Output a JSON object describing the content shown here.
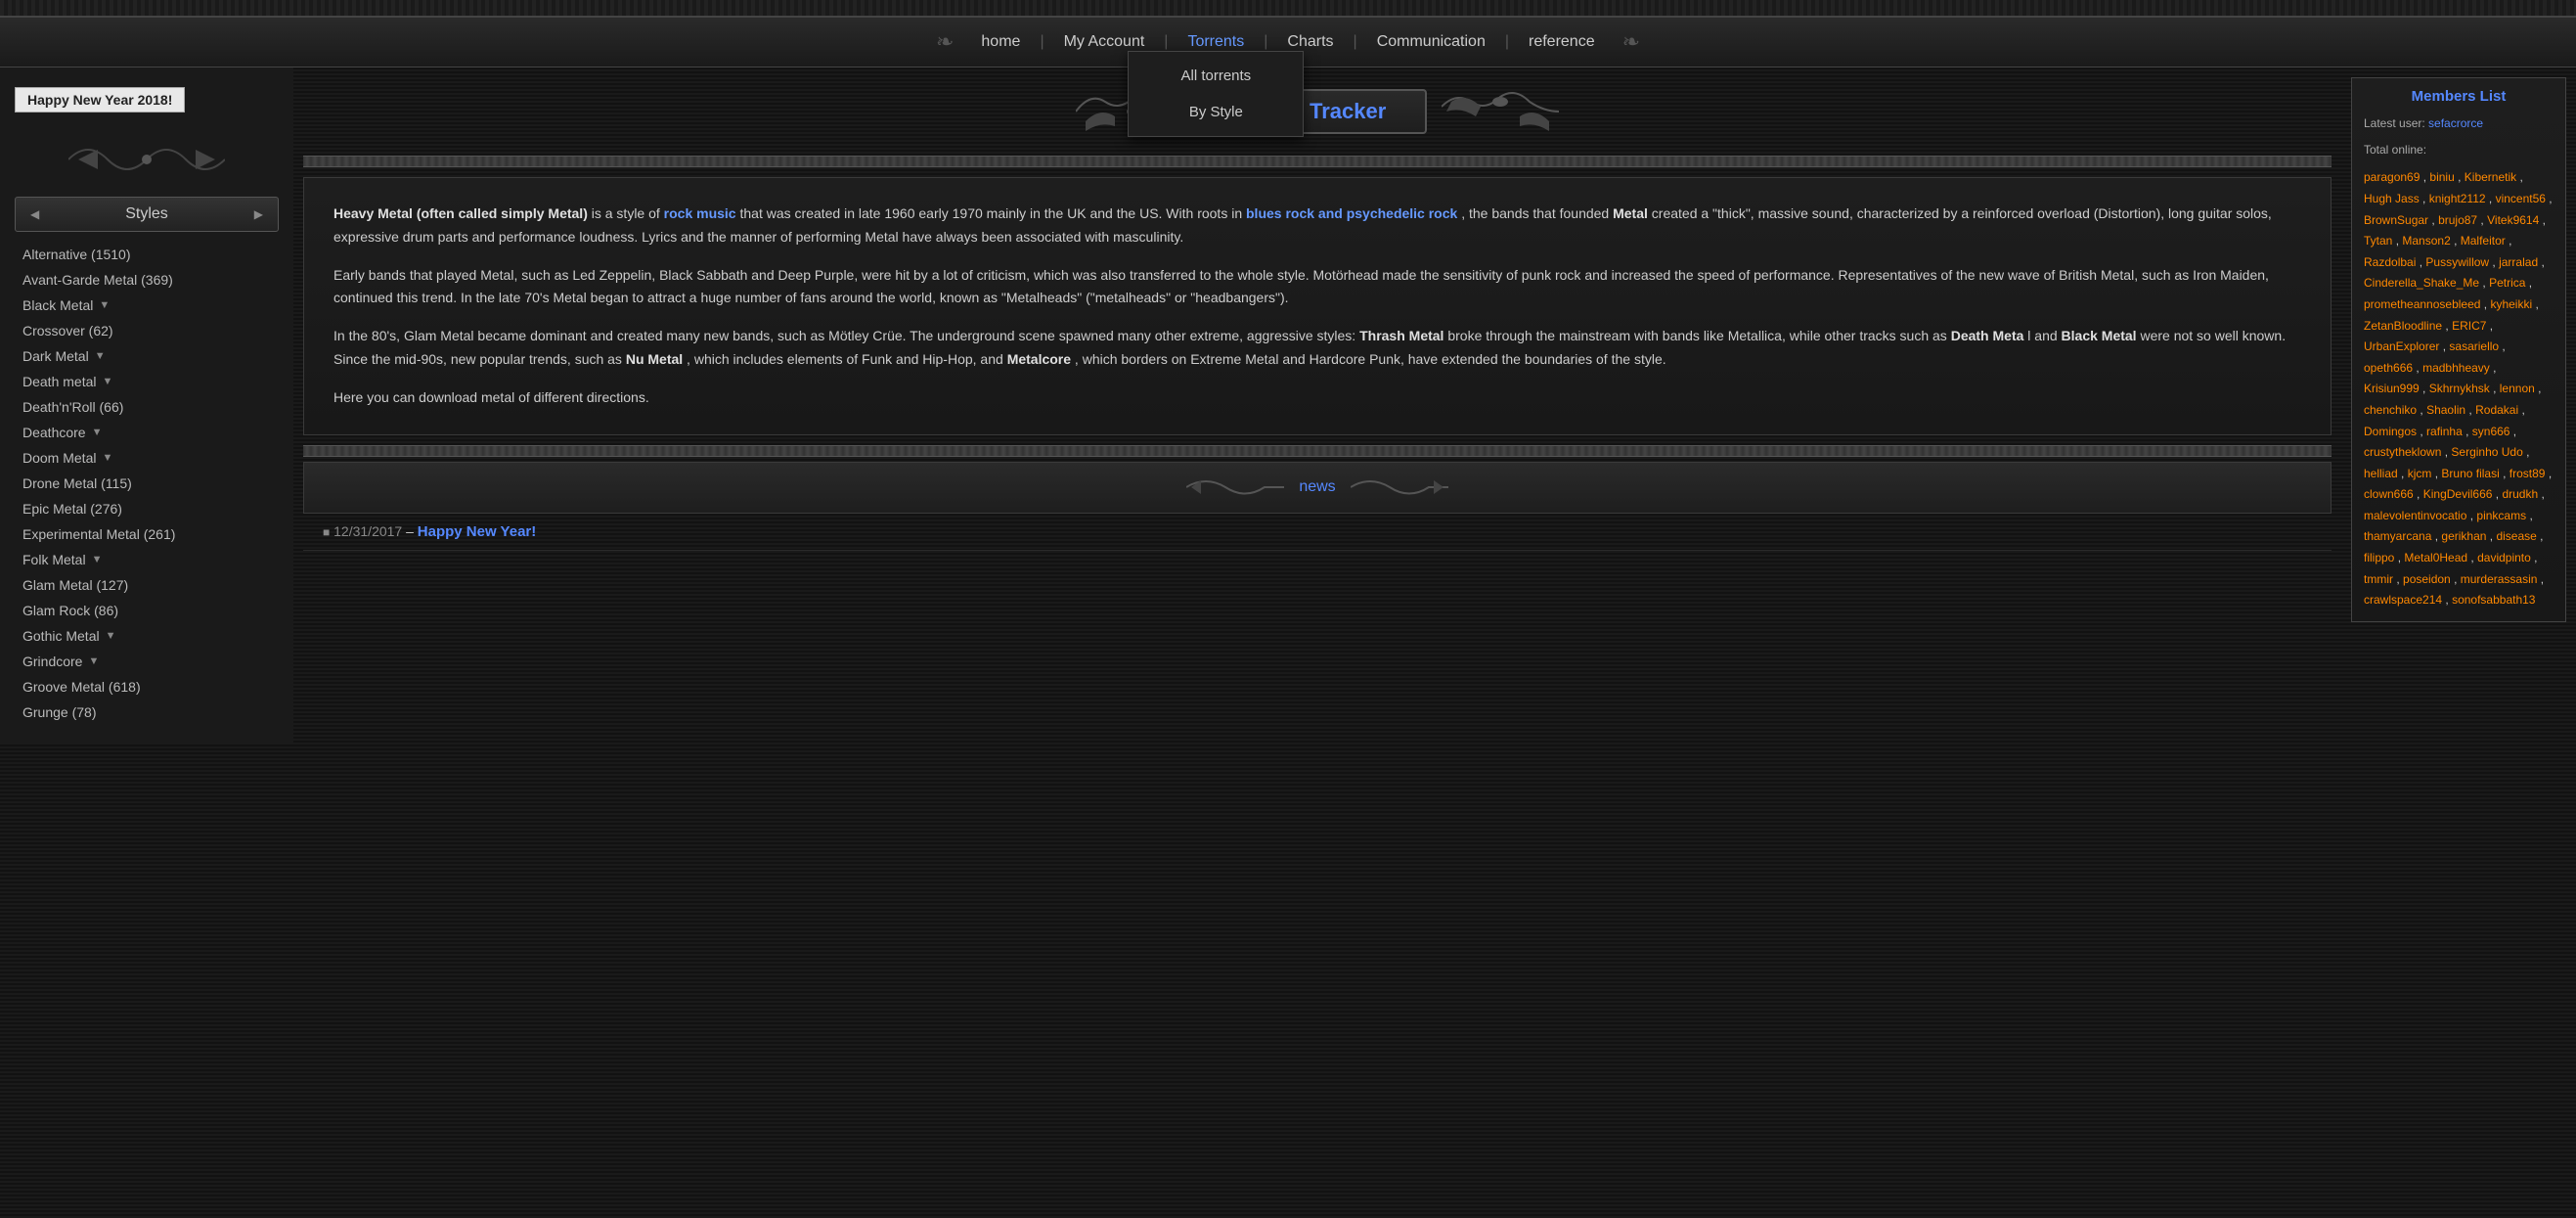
{
  "topbar": {
    "pattern": "decorative"
  },
  "nav": {
    "items": [
      {
        "label": "home",
        "id": "home",
        "active": false
      },
      {
        "label": "My Account",
        "id": "myaccount",
        "active": false
      },
      {
        "label": "Torrents",
        "id": "torrents",
        "active": true
      },
      {
        "label": "Charts",
        "id": "charts",
        "active": false
      },
      {
        "label": "Communication",
        "id": "communication",
        "active": false
      },
      {
        "label": "reference",
        "id": "reference",
        "active": false
      }
    ],
    "dropdown": {
      "visible": true,
      "items": [
        {
          "label": "All torrents",
          "id": "all-torrents"
        },
        {
          "label": "By Style",
          "id": "by-style"
        }
      ]
    }
  },
  "sidebar": {
    "header": "Styles",
    "items": [
      {
        "label": "Alternative (1510)",
        "has_dropdown": false
      },
      {
        "label": "Avant-Garde Metal (369)",
        "has_dropdown": false
      },
      {
        "label": "Black Metal",
        "has_dropdown": true
      },
      {
        "label": "Crossover (62)",
        "has_dropdown": false
      },
      {
        "label": "Dark Metal",
        "has_dropdown": true
      },
      {
        "label": "Death metal",
        "has_dropdown": true
      },
      {
        "label": "Death'n'Roll (66)",
        "has_dropdown": false
      },
      {
        "label": "Deathcore",
        "has_dropdown": true
      },
      {
        "label": "Doom Metal",
        "has_dropdown": true
      },
      {
        "label": "Drone Metal (115)",
        "has_dropdown": false
      },
      {
        "label": "Epic Metal (276)",
        "has_dropdown": false
      },
      {
        "label": "Experimental Metal (261)",
        "has_dropdown": false
      },
      {
        "label": "Folk Metal",
        "has_dropdown": true
      },
      {
        "label": "Glam Metal (127)",
        "has_dropdown": false
      },
      {
        "label": "Glam Rock (86)",
        "has_dropdown": false
      },
      {
        "label": "Gothic Metal",
        "has_dropdown": true
      },
      {
        "label": "Grindcore",
        "has_dropdown": true
      },
      {
        "label": "Groove Metal (618)",
        "has_dropdown": false
      },
      {
        "label": "Grunge (78)",
        "has_dropdown": false
      }
    ]
  },
  "header": {
    "title": "Metal Tracker",
    "happy_new_year": "Happy New Year 2018!"
  },
  "description": {
    "p1_before": "Heavy Metal (often called simply Metal)",
    "p1_mid1": " is a style of ",
    "p1_rock": "rock music",
    "p1_mid2": " that was created in late 1960 early 1970 mainly in the UK and the US. With roots in ",
    "p1_blues": "blues rock and psychedelic rock",
    "p1_mid3": " , the bands that founded ",
    "p1_metal": "Metal",
    "p1_end": " created a \"thick\", massive sound, characterized by a reinforced overload (Distortion), long guitar solos, expressive drum parts and performance loudness. Lyrics and the manner of performing Metal have always been associated with masculinity.",
    "p2": "Early bands that played Metal, such as Led Zeppelin, Black Sabbath and Deep Purple, were hit by a lot of criticism, which was also transferred to the whole style. Motörhead made the sensitivity of punk rock and increased the speed of performance. Representatives of the new wave of British Metal, such as Iron Maiden, continued this trend. In the late 70's Metal began to attract a huge number of fans around the world, known as \"Metalheads\" (\"metalheads\" or \"headbangers\").",
    "p3_start": "In the 80's, Glam Metal became dominant and created many new bands, such as Mötley Crüe. The underground scene spawned many other extreme, aggressive styles: ",
    "p3_thrash": "Thrash Metal",
    "p3_mid1": " broke through the mainstream with bands like Metallica, while other tracks such as ",
    "p3_death": "Death Meta",
    "p3_mid2": " l and ",
    "p3_black": "Black Metal",
    "p3_mid3": " were not so well known. Since the mid-90s, new popular trends, such as ",
    "p3_nu": "Nu Metal",
    "p3_mid4": " , which includes elements of Funk and Hip-Hop, and ",
    "p3_metalcore": "Metalcore",
    "p3_end": " , which borders on Extreme Metal and Hardcore Punk, have extended the boundaries of the style.",
    "p4": "Here you can download metal of different directions."
  },
  "news": {
    "title": "news",
    "items": [
      {
        "date": "12/31/2017",
        "separator": "–",
        "link_text": "Happy New Year!",
        "link_href": "#"
      }
    ]
  },
  "members": {
    "title": "Members List",
    "latest_label": "Latest user:",
    "latest_user": "sefacrorce",
    "total_label": "Total online:",
    "online_users": [
      "paragon69",
      "biniu",
      "Kibernetik",
      "Hugh Jass",
      "knight2112",
      "vincent56",
      "BrownSugar",
      "brujo87",
      "Vitek9614",
      "Tytan",
      "Manson2",
      "Malfeitor",
      "Razdolbai",
      "Pussywillow",
      "jarralad",
      "Cinderella_Shake_Me",
      "Petrica",
      "prometheannosebleed",
      "kyheikki",
      "ZetanBloodline",
      "ERIC7",
      "UrbanExplorer",
      "sasariello",
      "opeth666",
      "madbhheavy",
      "Krisiun999",
      "Skhrnykhsk",
      "lennon",
      "chenchiko",
      "Shaolin",
      "Rodakai",
      "Domingos",
      "rafinha",
      "syn666",
      "crustytheklown",
      "Serginho Udo",
      "helliad",
      "kjcm",
      "Bruno filasi",
      "frost89",
      "clown666",
      "KingDevil666",
      "drudkh",
      "malevolentinvocatio",
      "pinkcams",
      "thamyarcana",
      "gerikhan",
      "disease",
      "filippo",
      "Metal0Head",
      "davidpinto",
      "tmmir",
      "poseidon",
      "murderassasin",
      "crawlspace214",
      "sonofsabbath13"
    ]
  }
}
